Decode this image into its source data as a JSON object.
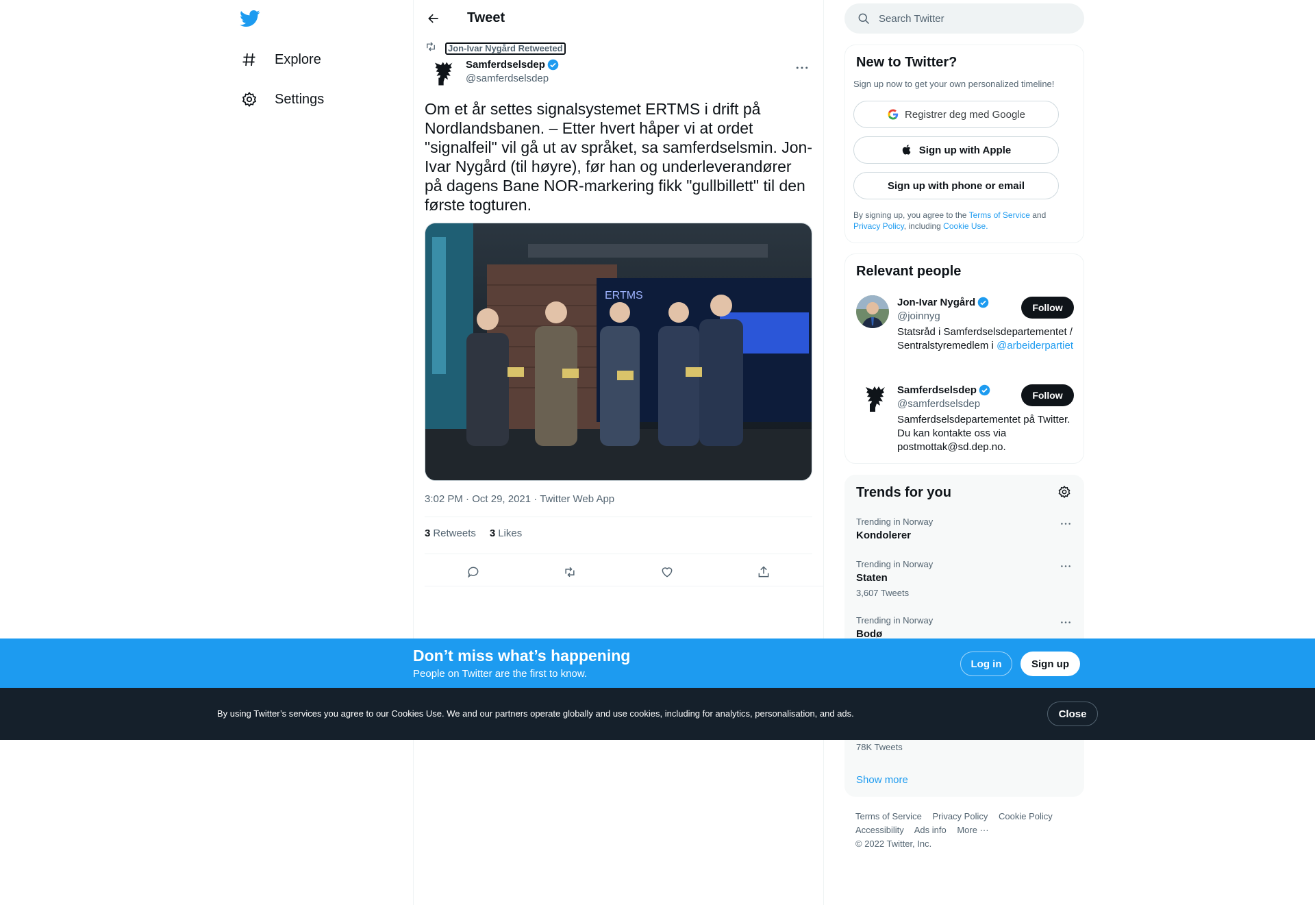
{
  "nav": {
    "logo_icon": "twitter-bird-icon",
    "items": [
      {
        "label": "Explore",
        "icon": "hashtag-icon"
      },
      {
        "label": "Settings",
        "icon": "gear-icon"
      }
    ]
  },
  "header": {
    "title": "Tweet"
  },
  "tweet": {
    "retweeted_by": "Jon-Ivar Nygård Retweeted",
    "author_name": "Samferdselsdep",
    "author_handle": "@samferdselsdep",
    "text": "Om et år settes signalsystemet ERTMS i drift på Nordlandsbanen. – Etter hvert håper vi at ordet \"signalfeil\" vil gå ut av språket, sa samferdselsmin. Jon-Ivar Nygård (til høyre), før han og underleverandører på dagens Bane NOR-markering fikk \"gullbillett\" til den første togturen.",
    "media_screen_text": "ERTMS",
    "time": "3:02 PM",
    "date": "Oct 29, 2021",
    "source": "Twitter Web App",
    "retweets_count": "3",
    "retweets_label": "Retweets",
    "likes_count": "3",
    "likes_label": "Likes"
  },
  "search": {
    "placeholder": "Search Twitter"
  },
  "signup_card": {
    "title": "New to Twitter?",
    "subtitle": "Sign up now to get your own personalized timeline!",
    "google_label": "Registrer deg med Google",
    "apple_label": "Sign up with Apple",
    "phone_label": "Sign up with phone or email",
    "terms_prefix": "By signing up, you agree to the ",
    "terms_link": "Terms of Service",
    "terms_and": " and ",
    "privacy_link": "Privacy Policy",
    "terms_including": ", including ",
    "cookie_link": "Cookie Use."
  },
  "people": {
    "title": "Relevant people",
    "items": [
      {
        "name": "Jon-Ivar Nygård",
        "handle": "@joinnyg",
        "bio": "Statsråd i Samferdselsdepartementet / Sentralstyremedlem i ",
        "bio_link": "@arbeiderpartiet",
        "follow": "Follow"
      },
      {
        "name": "Samferdselsdep",
        "handle": "@samferdselsdep",
        "bio": "Samferdselsdepartementet på Twitter. Du kan kontakte oss via postmottak@sd.dep.no.",
        "follow": "Follow"
      }
    ]
  },
  "trends": {
    "title": "Trends for you",
    "items": [
      {
        "context": "Trending in Norway",
        "name": "Kondolerer",
        "count": ""
      },
      {
        "context": "Trending in Norway",
        "name": "Staten",
        "count": "3,607 Tweets"
      },
      {
        "context": "Trending in Norway",
        "name": "Bodø",
        "count": ""
      },
      {
        "context": "",
        "name": "",
        "count": "78K Tweets"
      }
    ],
    "show_more": "Show more"
  },
  "footer": {
    "links": [
      "Terms of Service",
      "Privacy Policy",
      "Cookie Policy",
      "Accessibility",
      "Ads info",
      "More ···"
    ],
    "copyright": "© 2022 Twitter, Inc."
  },
  "banner": {
    "title": "Don’t miss what’s happening",
    "subtitle": "People on Twitter are the first to know.",
    "login": "Log in",
    "signup": "Sign up"
  },
  "cookie_bar": {
    "text": "By using Twitter’s services you agree to our Cookies Use. We and our partners operate globally and use cookies, including for analytics, personalisation, and ads.",
    "close": "Close"
  },
  "colors": {
    "accent": "#1d9bf0",
    "text_primary": "#0f1419",
    "text_secondary": "#536471",
    "cookie_bg": "#15202b"
  }
}
